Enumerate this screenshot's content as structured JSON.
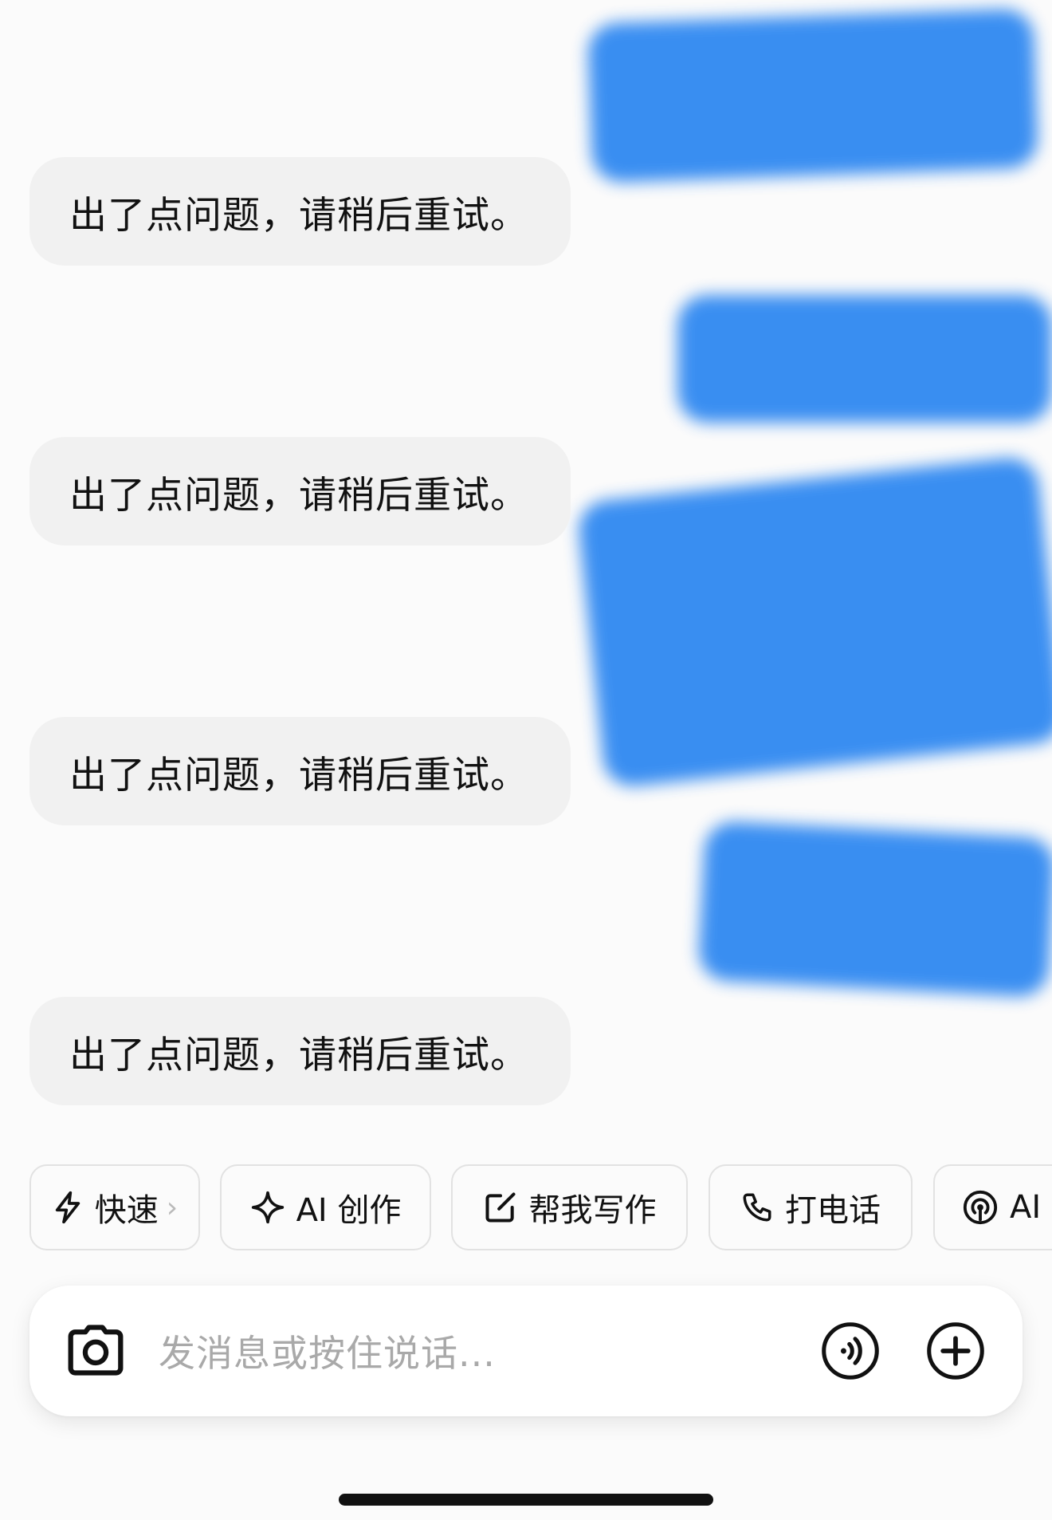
{
  "messages": [
    {
      "role": "assistant",
      "text": "出了点问题，请稍后重试。"
    },
    {
      "role": "assistant",
      "text": "出了点问题，请稍后重试。"
    },
    {
      "role": "assistant",
      "text": "出了点问题，请稍后重试。"
    },
    {
      "role": "assistant",
      "text": "出了点问题，请稍后重试。"
    }
  ],
  "quick_actions": [
    {
      "label": "快速",
      "icon": "lightning-icon",
      "has_chevron": true
    },
    {
      "label": "AI 创作",
      "icon": "sparkle-icon"
    },
    {
      "label": "帮我写作",
      "icon": "edit-icon"
    },
    {
      "label": "打电话",
      "icon": "phone-icon"
    },
    {
      "label": "AI",
      "icon": "broadcast-icon"
    }
  ],
  "composer": {
    "placeholder": "发消息或按住说话...",
    "camera_icon": "camera-icon",
    "voice_icon": "voice-wave-icon",
    "add_icon": "plus-circle-icon"
  },
  "colors": {
    "background": "#fbfbfb",
    "bubble": "#f1f1f1",
    "redaction_blue": "#1f7ff0",
    "text": "#111111",
    "placeholder": "#a9a9a9"
  }
}
